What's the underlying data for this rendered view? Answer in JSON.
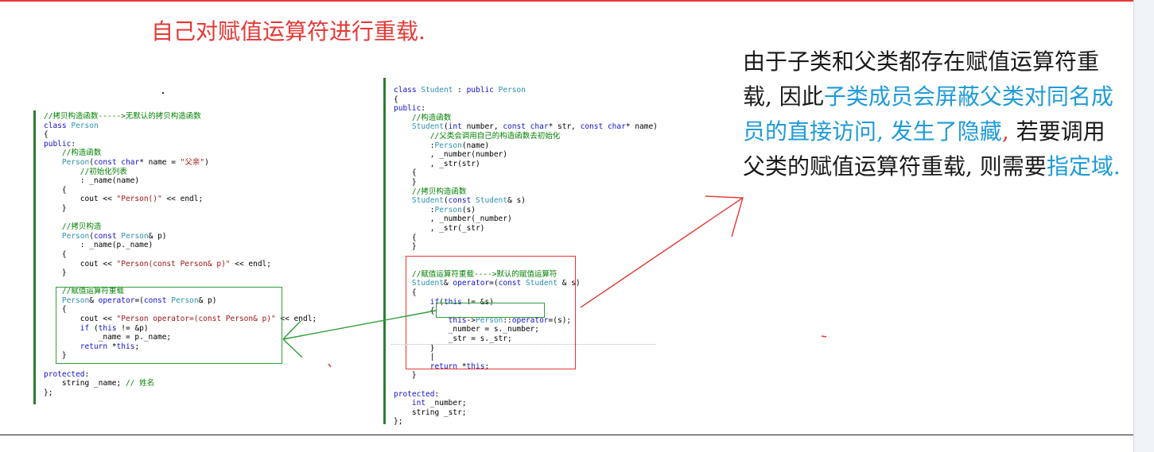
{
  "title": "自己对赋值运算符进行重载.",
  "note": {
    "part1": "由于子类和父类都存在赋值运算符重载, 因此",
    "part2": "子类成员会屏蔽父类对同名成员的直接访问, 发生了隐藏",
    "part3": ", ",
    "part4": "若要调用父类的赋值运算符重载, 则需要",
    "part5": "指定域."
  },
  "colors": {
    "title": "#e53935",
    "highlight": "#1e9bd7",
    "border_green": "#2e9d3a",
    "border_red": "#e53935"
  },
  "left_code": [
    "//拷贝构造函数----->无默认的拷贝构造函数",
    "class Person",
    "{",
    "public:",
    "    //构造函数",
    "    Person(const char* name = \"父亲\")",
    "        //初始化列表",
    "        : _name(name)",
    "    {",
    "        cout << \"Person()\" << endl;",
    "    }",
    "",
    "    //拷贝构造",
    "    Person(const Person& p)",
    "        : _name(p._name)",
    "    {",
    "        cout << \"Person(const Person& p)\" << endl;",
    "    }",
    "",
    "    //赋值运算符重载",
    "    Person& operator=(const Person& p)",
    "    {",
    "        cout << \"Person operator=(const Person& p)\" << endl;",
    "        if (this != &p)",
    "            _name = p._name;",
    "        return *this;",
    "    }",
    "",
    "protected:",
    "    string _name; // 姓名",
    "};"
  ],
  "right_code": [
    "class Student : public Person",
    "{",
    "public:",
    "    //构造函数",
    "    Student(int number, const char* str, const char* name)",
    "        //父类会调用自己的构造函数去初始化",
    "        :Person(name)",
    "        , _number(number)",
    "        , _str(str)",
    "    {",
    "    }",
    "    //拷贝构造函数",
    "    Student(const Student& s)",
    "        :Person(s)",
    "        , _number(_number)",
    "        , _str(_str)",
    "    {",
    "    }",
    "",
    "",
    "    //赋值运算符重载---->默认的赋值运算符",
    "    Student& operator=(const Student & s)",
    "    {",
    "        if(this != &s)",
    "        {",
    "            this->Person::operator=(s);",
    "            _number = s._number;",
    "            _str = s._str;",
    "        }",
    "        |",
    "        return *this;",
    "    }",
    "",
    "protected:",
    "    int _number;",
    "    string _str;",
    "};"
  ]
}
